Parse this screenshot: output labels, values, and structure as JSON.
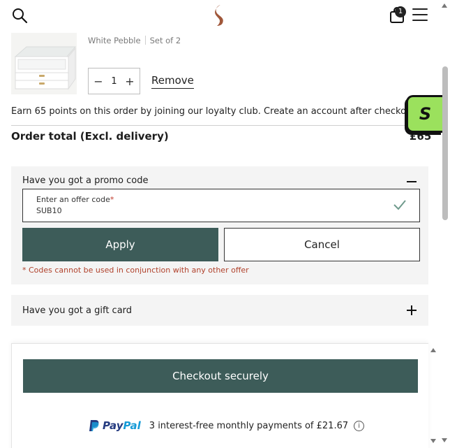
{
  "header": {
    "cart_count": "1",
    "icons": [
      "search-icon",
      "brand-logo",
      "bag-icon",
      "menu-icon"
    ]
  },
  "product": {
    "colour": "White Pebble",
    "set": "Set of 2",
    "quantity": "1",
    "minus": "−",
    "plus": "+",
    "remove_label": "Remove"
  },
  "loyalty": {
    "text": "Earn 65 points on this order by joining our loyalty club. Create an account after checkout.",
    "badge": "S"
  },
  "order": {
    "total_label": "Order total (Excl. delivery)",
    "total_value": "£65"
  },
  "promo": {
    "title": "Have you got a promo code",
    "field_label": "Enter an offer code",
    "required_mark": "*",
    "field_value": "SUB10",
    "apply_label": "Apply",
    "cancel_label": "Cancel",
    "note": "* Codes cannot be used in conjunction with any other offer"
  },
  "gift": {
    "title": "Have you got a gift card"
  },
  "checkout": {
    "button_label": "Checkout securely",
    "paypal_pay": "Pay",
    "paypal_pal": "Pal",
    "paypal_text": "3 interest-free monthly payments of £21.67",
    "info_glyph": "i"
  },
  "colors": {
    "primary_button": "#3d5c59",
    "accent_badge": "#9be15d",
    "error_text": "#b0412b",
    "panel_bg": "#f4f4f4"
  }
}
